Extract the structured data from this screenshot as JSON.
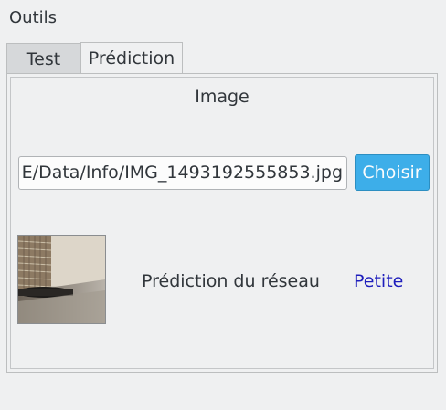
{
  "group": {
    "title": "Outils"
  },
  "tabs": [
    {
      "label": "Test",
      "active": false
    },
    {
      "label": "Prédiction",
      "active": true
    }
  ],
  "panel": {
    "section_label": "Image",
    "file_path": "E/Data/Info/IMG_1493192555853.jpg",
    "choose_label": "Choisir",
    "thumbnail_icon": "image-preview",
    "prediction_label": "Prédiction du réseau",
    "prediction_value": "Petite"
  },
  "colors": {
    "background": "#eff0f1",
    "accent_button": "#3daee9",
    "prediction_value": "#1e1ebc"
  }
}
